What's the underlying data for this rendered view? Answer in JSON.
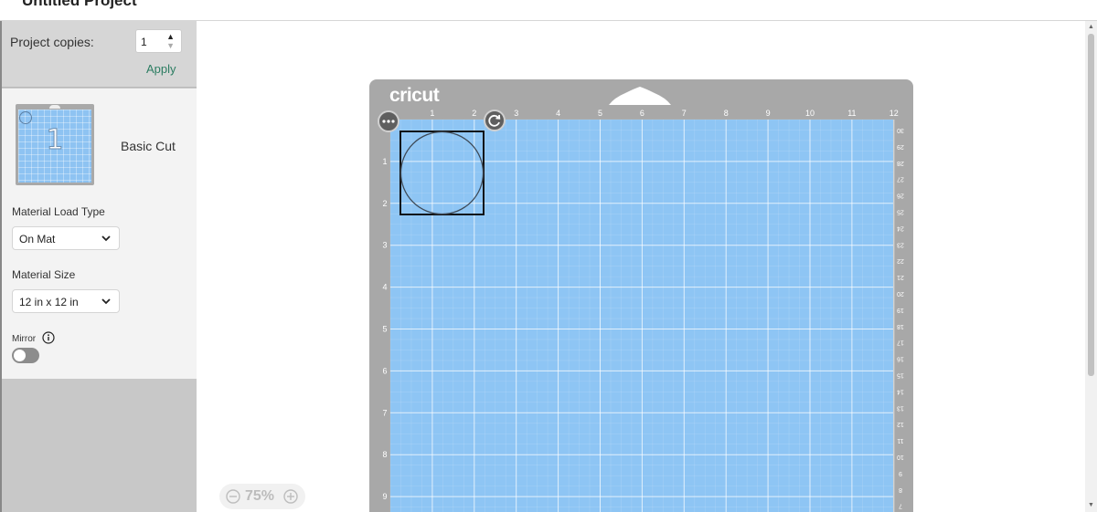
{
  "header": {
    "title": "Untitled Project"
  },
  "sidebar": {
    "copies_label": "Project copies:",
    "copies_value": "1",
    "apply_label": "Apply",
    "mat": {
      "thumb_number": "1",
      "name": "Basic Cut",
      "load_type_label": "Material Load Type",
      "load_type_value": "On Mat",
      "size_label": "Material Size",
      "size_value": "12 in x 12 in",
      "mirror_label": "Mirror",
      "mirror_on": false
    }
  },
  "canvas": {
    "brand": "cricut",
    "top_ruler": [
      "1",
      "2",
      "3",
      "4",
      "5",
      "6",
      "7",
      "8",
      "9",
      "10",
      "11",
      "12"
    ],
    "left_ruler": [
      "1",
      "2",
      "3",
      "4",
      "5",
      "6",
      "7",
      "8",
      "9"
    ],
    "right_ruler": [
      "30",
      "29",
      "28",
      "27",
      "26",
      "25",
      "24",
      "23",
      "22",
      "21",
      "20",
      "19",
      "18",
      "17",
      "16",
      "15",
      "14",
      "13",
      "12",
      "11",
      "10",
      "9",
      "8",
      "7"
    ],
    "zoom_value": "75%"
  },
  "colors": {
    "mat_frame": "#a8a8a8",
    "mat_surface": "#8ec5f4",
    "accent": "#2c7d62"
  }
}
